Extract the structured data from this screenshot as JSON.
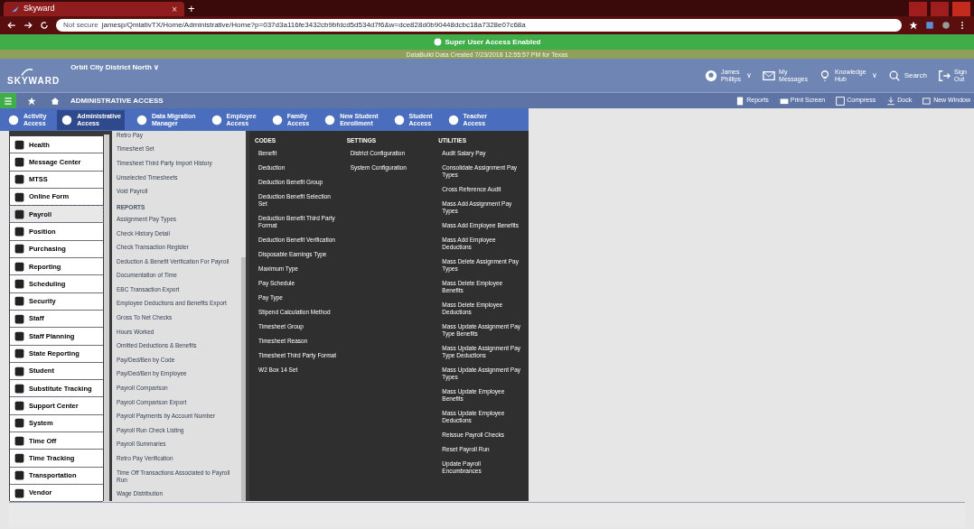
{
  "browser": {
    "tab_title": "Skyward",
    "tab_close": "×",
    "new_tab": "+",
    "url_security": "Not secure",
    "url": "jamesp/QmlativTX/Home/Administrative/Home?p=037d3a116fe3432cb9bfdcd5d534d7f6&w=dce828d0b90448dcbc18a7328e07c68a"
  },
  "banner": {
    "title": "Super User Access Enabled",
    "subtitle": "DataBuild Data Created 7/23/2018 12:55:57 PM for Texas"
  },
  "header": {
    "logo": "SKYWARD",
    "district": "Orbit City District North",
    "caret": "∨",
    "user": [
      "James",
      "Phillips"
    ],
    "user_caret": "∨",
    "knowledge_caret": "∨",
    "messages": [
      "My",
      "Messages"
    ],
    "knowledge": [
      "Knowledge",
      "Hub"
    ],
    "search": "Search",
    "sign_out": [
      "Sign",
      "Out"
    ]
  },
  "navbar": {
    "title": "ADMINISTRATIVE ACCESS",
    "tools": [
      "Reports",
      "Print Screen",
      "Compress",
      "Dock",
      "New Window"
    ]
  },
  "access_tabs": [
    {
      "label": [
        "Activity",
        "Access"
      ],
      "selected": false
    },
    {
      "label": [
        "Administrative",
        "Access"
      ],
      "selected": true
    },
    {
      "label": [
        "Data Migration",
        "Manager"
      ],
      "selected": false
    },
    {
      "label": [
        "Employee",
        "Access"
      ],
      "selected": false
    },
    {
      "label": [
        "Family",
        "Access"
      ],
      "selected": false
    },
    {
      "label": [
        "New Student",
        "Enrollment"
      ],
      "selected": false
    },
    {
      "label": [
        "Student",
        "Access"
      ],
      "selected": false
    },
    {
      "label": [
        "Teacher",
        "Access"
      ],
      "selected": false
    }
  ],
  "modules": [
    {
      "label": "Health",
      "selected": false
    },
    {
      "label": "Message Center",
      "selected": false
    },
    {
      "label": "MTSS",
      "selected": false
    },
    {
      "label": "Online Form",
      "selected": false
    },
    {
      "label": "Payroll",
      "selected": true
    },
    {
      "label": "Position",
      "selected": false
    },
    {
      "label": "Purchasing",
      "selected": false
    },
    {
      "label": "Reporting",
      "selected": false
    },
    {
      "label": "Scheduling",
      "selected": false
    },
    {
      "label": "Security",
      "selected": false
    },
    {
      "label": "Staff",
      "selected": false
    },
    {
      "label": "Staff Planning",
      "selected": false
    },
    {
      "label": "State Reporting",
      "selected": false
    },
    {
      "label": "Student",
      "selected": false
    },
    {
      "label": "Substitute Tracking",
      "selected": false
    },
    {
      "label": "Support Center",
      "selected": false
    },
    {
      "label": "System",
      "selected": false
    },
    {
      "label": "Time Off",
      "selected": false
    },
    {
      "label": "Time Tracking",
      "selected": false
    },
    {
      "label": "Transportation",
      "selected": false
    },
    {
      "label": "Vendor",
      "selected": false
    }
  ],
  "payroll_menu": [
    {
      "kind": "item",
      "label": "Retro Pay"
    },
    {
      "kind": "item",
      "label": "Timesheet Set"
    },
    {
      "kind": "item",
      "label": "Timesheet Third Party Import History"
    },
    {
      "kind": "item",
      "label": "Unselected Timesheets"
    },
    {
      "kind": "item",
      "label": "Void Payroll"
    },
    {
      "kind": "heading",
      "label": "REPORTS"
    },
    {
      "kind": "item",
      "label": "Assignment Pay Types"
    },
    {
      "kind": "item",
      "label": "Check History Detail"
    },
    {
      "kind": "item",
      "label": "Check Transaction Register"
    },
    {
      "kind": "item",
      "label": "Deduction & Benefit Verification For Payroll"
    },
    {
      "kind": "item",
      "label": "Documentation of Time"
    },
    {
      "kind": "item",
      "label": "EBC Transaction Export"
    },
    {
      "kind": "item",
      "label": "Employee Deductions and Benefits Export"
    },
    {
      "kind": "item",
      "label": "Gross To Net Checks"
    },
    {
      "kind": "item",
      "label": "Hours Worked"
    },
    {
      "kind": "item",
      "label": "Omitted Deductions & Benefits"
    },
    {
      "kind": "item",
      "label": "Pay/Ded/Ben by Code"
    },
    {
      "kind": "item",
      "label": "Pay/Ded/Ben by Employee"
    },
    {
      "kind": "item",
      "label": "Payroll Comparison"
    },
    {
      "kind": "item",
      "label": "Payroll Comparison Export"
    },
    {
      "kind": "item",
      "label": "Payroll Payments by Account Number"
    },
    {
      "kind": "item",
      "label": "Payroll Run Check Listing"
    },
    {
      "kind": "item",
      "label": "Payroll Summaries"
    },
    {
      "kind": "item",
      "label": "Retro Pay Verification"
    },
    {
      "kind": "item",
      "label": "Time Off Transactions Associated to Payroll Run"
    },
    {
      "kind": "item",
      "label": "Wage Distribution"
    }
  ],
  "groups": [
    {
      "heading": "CODES",
      "items": [
        "Benefit",
        "Deduction",
        "Deduction Benefit Group",
        "Deduction Benefit Selection Set",
        "Deduction Benefit Third Party Format",
        "Deduction Benefit Verification",
        "Disposable Earnings Type",
        "Maximum Type",
        "Pay Schedule",
        "Pay Type",
        "Stipend Calculation Method",
        "Timesheet Group",
        "Timesheet Reason",
        "Timesheet Third Party Format",
        "W2 Box 14 Set"
      ]
    },
    {
      "heading": "SETTINGS",
      "items": [
        "District Configuration",
        "System Configuration"
      ]
    },
    {
      "heading": "UTILITIES",
      "items": [
        "Audit Salary Pay",
        "Consolidate Assignment Pay Types",
        "Cross Reference Audit",
        "Mass Add Assignment Pay Types",
        "Mass Add Employee Benefits",
        "Mass Add Employee Deductions",
        "Mass Delete Assignment Pay Types",
        "Mass Delete Employee Benefits",
        "Mass Delete Employee Deductions",
        "Mass Update Assignment Pay Type Benefits",
        "Mass Update Assignment Pay Type Deductions",
        "Mass Update Assignment Pay Types",
        "Mass Update Employee Benefits",
        "Mass Update Employee Deductions",
        "Reissue Payroll Checks",
        "Reset Payroll Run",
        "Update Payroll Encumbrances"
      ]
    }
  ]
}
